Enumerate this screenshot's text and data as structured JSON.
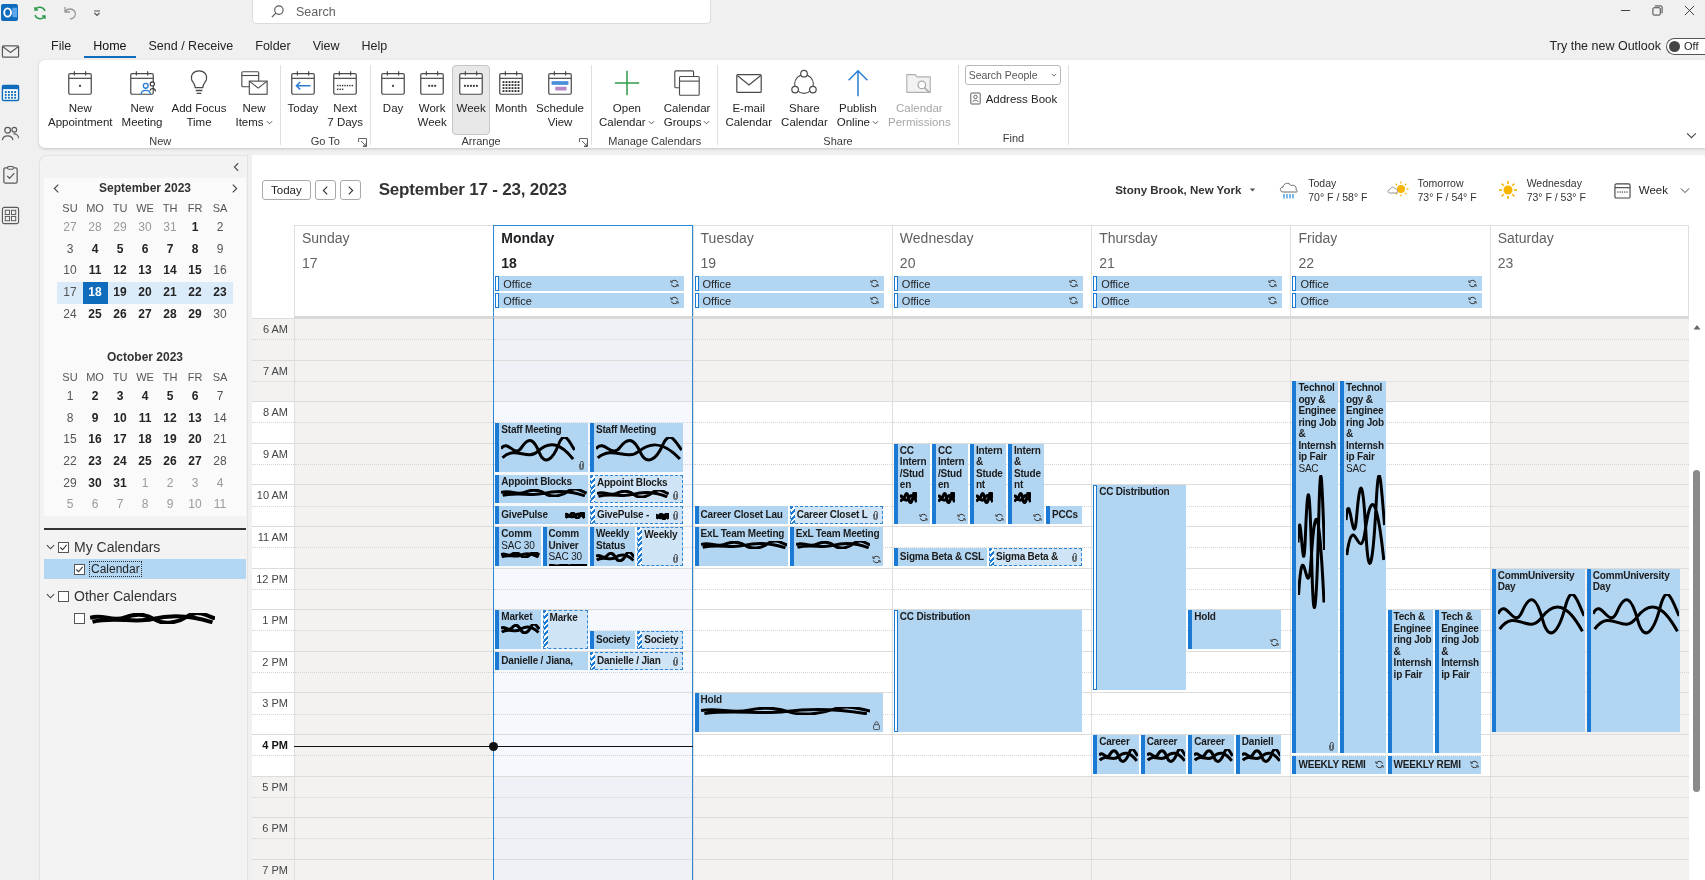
{
  "title_bar": {
    "search": {
      "placeholder": "Search"
    }
  },
  "nav_rail": [
    {
      "selected": false
    },
    {
      "selected": true
    },
    {
      "selected": false
    },
    {
      "selected": false
    },
    {
      "selected": false
    }
  ],
  "menu_tabs": [
    {
      "label": "File",
      "selected": false
    },
    {
      "label": "Home",
      "selected": true
    },
    {
      "label": "Send / Receive",
      "selected": false
    },
    {
      "label": "Folder",
      "selected": false
    },
    {
      "label": "View",
      "selected": false
    },
    {
      "label": "Help",
      "selected": false
    }
  ],
  "new_outlook": {
    "label": "Try the new Outlook",
    "toggle_text": "Off",
    "on": false
  },
  "ribbon": {
    "groups": [
      {
        "label": "New",
        "launcher": false,
        "buttons": [
          {
            "label": "New\nAppointment",
            "menu": false,
            "selected": false,
            "disabled": false
          },
          {
            "label": "New\nMeeting",
            "menu": false,
            "selected": false,
            "disabled": false
          },
          {
            "label": "Add Focus\nTime",
            "menu": false,
            "selected": false,
            "disabled": false
          },
          {
            "label": "New\nItems",
            "menu": true,
            "selected": false,
            "disabled": false
          }
        ]
      },
      {
        "label": "Go To",
        "launcher": true,
        "buttons": [
          {
            "label": "Today",
            "menu": false,
            "selected": false,
            "disabled": false
          },
          {
            "label": "Next\n7 Days",
            "menu": false,
            "selected": false,
            "disabled": false
          }
        ]
      },
      {
        "label": "Arrange",
        "launcher": true,
        "buttons": [
          {
            "label": "Day",
            "menu": false,
            "selected": false,
            "disabled": false
          },
          {
            "label": "Work\nWeek",
            "menu": false,
            "selected": false,
            "disabled": false
          },
          {
            "label": "Week",
            "menu": false,
            "selected": true,
            "disabled": false
          },
          {
            "label": "Month",
            "menu": false,
            "selected": false,
            "disabled": false
          },
          {
            "label": "Schedule\nView",
            "menu": false,
            "selected": false,
            "disabled": false
          }
        ]
      },
      {
        "label": "Manage Calendars",
        "launcher": false,
        "buttons": [
          {
            "label": "Open\nCalendar",
            "menu": true,
            "selected": false,
            "disabled": false
          },
          {
            "label": "Calendar\nGroups",
            "menu": true,
            "selected": false,
            "disabled": false
          }
        ]
      },
      {
        "label": "Share",
        "launcher": false,
        "buttons": [
          {
            "label": "E-mail\nCalendar",
            "menu": false,
            "selected": false,
            "disabled": false
          },
          {
            "label": "Share\nCalendar",
            "menu": false,
            "selected": false,
            "disabled": false
          },
          {
            "label": "Publish\nOnline",
            "menu": true,
            "selected": false,
            "disabled": false
          },
          {
            "label": "Calendar\nPermissions",
            "menu": false,
            "selected": false,
            "disabled": true
          }
        ]
      }
    ],
    "find": {
      "label": "Find",
      "search_people": {
        "placeholder": "Search People"
      },
      "address_book": {
        "label": "Address Book"
      }
    }
  },
  "sidebar": {
    "months": [
      {
        "title": "September 2023",
        "arrows": true,
        "weekdays": [
          "SU",
          "MO",
          "TU",
          "WE",
          "TH",
          "FR",
          "SA"
        ],
        "weeks": [
          {
            "selected": false,
            "days": [
              {
                "day": "27",
                "other_month": true,
                "busy": false,
                "today": false
              },
              {
                "day": "28",
                "other_month": true,
                "busy": false,
                "today": false
              },
              {
                "day": "29",
                "other_month": true,
                "busy": false,
                "today": false
              },
              {
                "day": "30",
                "other_month": true,
                "busy": false,
                "today": false
              },
              {
                "day": "31",
                "other_month": true,
                "busy": false,
                "today": false
              },
              {
                "day": "1",
                "other_month": false,
                "busy": true,
                "today": false
              },
              {
                "day": "2",
                "other_month": false,
                "busy": false,
                "today": false
              }
            ]
          },
          {
            "selected": false,
            "days": [
              {
                "day": "3",
                "other_month": false,
                "busy": false,
                "today": false
              },
              {
                "day": "4",
                "other_month": false,
                "busy": true,
                "today": false
              },
              {
                "day": "5",
                "other_month": false,
                "busy": true,
                "today": false
              },
              {
                "day": "6",
                "other_month": false,
                "busy": true,
                "today": false
              },
              {
                "day": "7",
                "other_month": false,
                "busy": true,
                "today": false
              },
              {
                "day": "8",
                "other_month": false,
                "busy": true,
                "today": false
              },
              {
                "day": "9",
                "other_month": false,
                "busy": false,
                "today": false
              }
            ]
          },
          {
            "selected": false,
            "days": [
              {
                "day": "10",
                "other_month": false,
                "busy": false,
                "today": false
              },
              {
                "day": "11",
                "other_month": false,
                "busy": true,
                "today": false
              },
              {
                "day": "12",
                "other_month": false,
                "busy": true,
                "today": false
              },
              {
                "day": "13",
                "other_month": false,
                "busy": true,
                "today": false
              },
              {
                "day": "14",
                "other_month": false,
                "busy": true,
                "today": false
              },
              {
                "day": "15",
                "other_month": false,
                "busy": true,
                "today": false
              },
              {
                "day": "16",
                "other_month": false,
                "busy": false,
                "today": false
              }
            ]
          },
          {
            "selected": true,
            "days": [
              {
                "day": "17",
                "other_month": false,
                "busy": false,
                "today": false
              },
              {
                "day": "18",
                "other_month": false,
                "busy": true,
                "today": true
              },
              {
                "day": "19",
                "other_month": false,
                "busy": true,
                "today": false
              },
              {
                "day": "20",
                "other_month": false,
                "busy": true,
                "today": false
              },
              {
                "day": "21",
                "other_month": false,
                "busy": true,
                "today": false
              },
              {
                "day": "22",
                "other_month": false,
                "busy": true,
                "today": false
              },
              {
                "day": "23",
                "other_month": false,
                "busy": true,
                "today": false
              }
            ]
          },
          {
            "selected": false,
            "days": [
              {
                "day": "24",
                "other_month": false,
                "busy": false,
                "today": false
              },
              {
                "day": "25",
                "other_month": false,
                "busy": true,
                "today": false
              },
              {
                "day": "26",
                "other_month": false,
                "busy": true,
                "today": false
              },
              {
                "day": "27",
                "other_month": false,
                "busy": true,
                "today": false
              },
              {
                "day": "28",
                "other_month": false,
                "busy": true,
                "today": false
              },
              {
                "day": "29",
                "other_month": false,
                "busy": true,
                "today": false
              },
              {
                "day": "30",
                "other_month": false,
                "busy": false,
                "today": false
              }
            ]
          }
        ]
      },
      {
        "title": "October 2023",
        "arrows": false,
        "weekdays": [
          "SU",
          "MO",
          "TU",
          "WE",
          "TH",
          "FR",
          "SA"
        ],
        "weeks": [
          {
            "selected": false,
            "days": [
              {
                "day": "1",
                "other_month": false,
                "busy": false,
                "today": false
              },
              {
                "day": "2",
                "other_month": false,
                "busy": true,
                "today": false
              },
              {
                "day": "3",
                "other_month": false,
                "busy": true,
                "today": false
              },
              {
                "day": "4",
                "other_month": false,
                "busy": true,
                "today": false
              },
              {
                "day": "5",
                "other_month": false,
                "busy": true,
                "today": false
              },
              {
                "day": "6",
                "other_month": false,
                "busy": true,
                "today": false
              },
              {
                "day": "7",
                "other_month": false,
                "busy": false,
                "today": false
              }
            ]
          },
          {
            "selected": false,
            "days": [
              {
                "day": "8",
                "other_month": false,
                "busy": false,
                "today": false
              },
              {
                "day": "9",
                "other_month": false,
                "busy": true,
                "today": false
              },
              {
                "day": "10",
                "other_month": false,
                "busy": true,
                "today": false
              },
              {
                "day": "11",
                "other_month": false,
                "busy": true,
                "today": false
              },
              {
                "day": "12",
                "other_month": false,
                "busy": true,
                "today": false
              },
              {
                "day": "13",
                "other_month": false,
                "busy": true,
                "today": false
              },
              {
                "day": "14",
                "other_month": false,
                "busy": false,
                "today": false
              }
            ]
          },
          {
            "selected": false,
            "days": [
              {
                "day": "15",
                "other_month": false,
                "busy": false,
                "today": false
              },
              {
                "day": "16",
                "other_month": false,
                "busy": true,
                "today": false
              },
              {
                "day": "17",
                "other_month": false,
                "busy": true,
                "today": false
              },
              {
                "day": "18",
                "other_month": false,
                "busy": true,
                "today": false
              },
              {
                "day": "19",
                "other_month": false,
                "busy": true,
                "today": false
              },
              {
                "day": "20",
                "other_month": false,
                "busy": true,
                "today": false
              },
              {
                "day": "21",
                "other_month": false,
                "busy": false,
                "today": false
              }
            ]
          },
          {
            "selected": false,
            "days": [
              {
                "day": "22",
                "other_month": false,
                "busy": false,
                "today": false
              },
              {
                "day": "23",
                "other_month": false,
                "busy": true,
                "today": false
              },
              {
                "day": "24",
                "other_month": false,
                "busy": true,
                "today": false
              },
              {
                "day": "25",
                "other_month": false,
                "busy": true,
                "today": false
              },
              {
                "day": "26",
                "other_month": false,
                "busy": true,
                "today": false
              },
              {
                "day": "27",
                "other_month": false,
                "busy": true,
                "today": false
              },
              {
                "day": "28",
                "other_month": false,
                "busy": false,
                "today": false
              }
            ]
          },
          {
            "selected": false,
            "days": [
              {
                "day": "29",
                "other_month": false,
                "busy": false,
                "today": false
              },
              {
                "day": "30",
                "other_month": false,
                "busy": true,
                "today": false
              },
              {
                "day": "31",
                "other_month": false,
                "busy": true,
                "today": false
              },
              {
                "day": "1",
                "other_month": true,
                "busy": false,
                "today": false
              },
              {
                "day": "2",
                "other_month": true,
                "busy": false,
                "today": false
              },
              {
                "day": "3",
                "other_month": true,
                "busy": false,
                "today": false
              },
              {
                "day": "4",
                "other_month": true,
                "busy": false,
                "today": false
              }
            ]
          },
          {
            "selected": false,
            "days": [
              {
                "day": "5",
                "other_month": true,
                "busy": false,
                "today": false
              },
              {
                "day": "6",
                "other_month": true,
                "busy": false,
                "today": false
              },
              {
                "day": "7",
                "other_month": true,
                "busy": false,
                "today": false
              },
              {
                "day": "8",
                "other_month": true,
                "busy": false,
                "today": false
              },
              {
                "day": "9",
                "other_month": true,
                "busy": false,
                "today": false
              },
              {
                "day": "10",
                "other_month": true,
                "busy": false,
                "today": false
              },
              {
                "day": "11",
                "other_month": true,
                "busy": false,
                "today": false
              }
            ]
          }
        ]
      }
    ],
    "calendars": [
      {
        "label": "My Calendars",
        "checked": true,
        "expanded": true,
        "selected": false,
        "children": [
          {
            "label": "Calendar",
            "checked": true,
            "selected": true,
            "redacted": false
          }
        ]
      },
      {
        "label": "Other Calendars",
        "checked": false,
        "expanded": true,
        "selected": false,
        "children": [
          {
            "checked": false,
            "selected": false,
            "redacted": true
          }
        ]
      }
    ]
  },
  "calendar": {
    "toolbar": {
      "today_button": "Today",
      "title": "September 17 - 23, 2023",
      "location": "Stony Brook, New York",
      "weather": [
        {
          "kind": "rain",
          "day": "Today",
          "temps": "70° F / 58° F"
        },
        {
          "kind": "partly_sunny",
          "day": "Tomorrow",
          "temps": "73° F / 54° F"
        },
        {
          "kind": "sunny",
          "day": "Wednesday",
          "temps": "73° F / 53° F"
        }
      ],
      "view": "Week"
    },
    "hours": [
      {
        "label": "6 AM",
        "current": false
      },
      {
        "label": "7 AM",
        "current": false
      },
      {
        "label": "8 AM",
        "current": false
      },
      {
        "label": "9 AM",
        "current": false
      },
      {
        "label": "10 AM",
        "current": false
      },
      {
        "label": "11 AM",
        "current": false
      },
      {
        "label": "12 PM",
        "current": false
      },
      {
        "label": "1 PM",
        "current": false
      },
      {
        "label": "2 PM",
        "current": false
      },
      {
        "label": "3 PM",
        "current": false
      },
      {
        "label": "4 PM",
        "current": true
      },
      {
        "label": "5 PM",
        "current": false
      },
      {
        "label": "6 PM",
        "current": false
      },
      {
        "label": "7 PM",
        "current": false
      }
    ],
    "days": [
      {
        "name": "Sunday",
        "date": "17",
        "today": false,
        "workday": false
      },
      {
        "name": "Monday",
        "date": "18",
        "today": true,
        "workday": true,
        "all_day": [
          {
            "title": "Office",
            "kind": "free",
            "recurring": true
          },
          {
            "title": "Office",
            "kind": "free",
            "recurring": true
          }
        ],
        "events": [
          {
            "title": "Staff Meeting",
            "kind": "busy",
            "recurring": false,
            "attachment": true,
            "private": false,
            "redacted": true
          },
          {
            "title": "Staff Meeting",
            "kind": "busy",
            "recurring": false,
            "attachment": false,
            "private": false,
            "redacted": true
          },
          {
            "title": "Appoint Blocks",
            "kind": "busy",
            "recurring": false,
            "attachment": false,
            "private": false,
            "redacted": true
          },
          {
            "title": "Appoint Blocks",
            "kind": "tentative",
            "recurring": false,
            "attachment": true,
            "private": false,
            "redacted": true
          },
          {
            "title": "GivePulse",
            "kind": "busy",
            "recurring": false,
            "attachment": false,
            "private": false,
            "redacted": true
          },
          {
            "title": "GivePulse -",
            "kind": "tentative",
            "recurring": false,
            "attachment": true,
            "private": false,
            "redacted": true
          },
          {
            "title": "Comm",
            "location": "SAC 30",
            "kind": "busy",
            "recurring": false,
            "attachment": false,
            "private": false,
            "redacted": true
          },
          {
            "title": "Comm Univer",
            "location": "SAC 30",
            "kind": "busy",
            "recurring": false,
            "attachment": false,
            "private": false,
            "redacted": true
          },
          {
            "title": "Weekly Status",
            "kind": "busy",
            "recurring": false,
            "attachment": false,
            "private": false,
            "redacted": true
          },
          {
            "title": "Weekly",
            "kind": "tentative",
            "recurring": false,
            "attachment": true,
            "private": false,
            "redacted": false
          },
          {
            "title": "Market",
            "kind": "busy",
            "recurring": false,
            "attachment": false,
            "private": false,
            "redacted": true
          },
          {
            "title": "Marke",
            "kind": "tentative",
            "recurring": false,
            "attachment": false,
            "private": false,
            "redacted": false
          },
          {
            "title": "Society",
            "kind": "busy",
            "recurring": false,
            "attachment": false,
            "private": false,
            "redacted": false
          },
          {
            "title": "Society",
            "kind": "tentative",
            "recurring": false,
            "attachment": false,
            "private": false,
            "redacted": false
          },
          {
            "title": "Danielle / Jiana,",
            "kind": "busy",
            "recurring": false,
            "attachment": false,
            "private": false,
            "redacted": false
          },
          {
            "title": "Danielle / Jian",
            "kind": "tentative",
            "recurring": false,
            "attachment": true,
            "private": false,
            "redacted": false
          }
        ]
      },
      {
        "name": "Tuesday",
        "date": "19",
        "today": false,
        "workday": true,
        "all_day": [
          {
            "title": "Office",
            "kind": "free",
            "recurring": true
          },
          {
            "title": "Office",
            "kind": "free",
            "recurring": true
          }
        ],
        "events": [
          {
            "title": "Career Closet Lau",
            "kind": "busy",
            "recurring": false,
            "attachment": false,
            "private": false,
            "redacted": false
          },
          {
            "title": "Career Closet L",
            "kind": "tentative",
            "recurring": false,
            "attachment": true,
            "private": false,
            "redacted": false
          },
          {
            "title": "ExL Team Meeting",
            "kind": "busy",
            "recurring": false,
            "attachment": false,
            "private": false,
            "redacted": true
          },
          {
            "title": "ExL Team Meeting",
            "kind": "busy",
            "recurring": true,
            "attachment": false,
            "private": false,
            "redacted": true
          },
          {
            "title": "Hold",
            "kind": "busy",
            "recurring": false,
            "attachment": false,
            "private": true,
            "redacted": true
          }
        ]
      },
      {
        "name": "Wednesday",
        "date": "20",
        "today": false,
        "workday": true,
        "all_day": [
          {
            "title": "Office",
            "kind": "free",
            "recurring": true
          },
          {
            "title": "Office",
            "kind": "free",
            "recurring": true
          }
        ],
        "events": [
          {
            "title": "CC Intern/Studen",
            "kind": "busy",
            "recurring": true,
            "attachment": false,
            "private": false,
            "redacted": true
          },
          {
            "title": "CC Intern/Studen",
            "kind": "busy",
            "recurring": true,
            "attachment": false,
            "private": false,
            "redacted": true
          },
          {
            "title": "Intern & Student",
            "kind": "busy",
            "recurring": true,
            "attachment": false,
            "private": false,
            "redacted": true
          },
          {
            "title": "Intern & Student",
            "kind": "busy",
            "recurring": true,
            "attachment": false,
            "private": false,
            "redacted": true
          },
          {
            "title": "PCCs",
            "kind": "busy",
            "recurring": false,
            "attachment": false,
            "private": false,
            "redacted": false
          },
          {
            "title": "Sigma Beta & CSL",
            "kind": "busy",
            "recurring": false,
            "attachment": false,
            "private": false,
            "redacted": false
          },
          {
            "title": "Sigma Beta &",
            "kind": "tentative",
            "recurring": false,
            "attachment": true,
            "private": false,
            "redacted": false
          },
          {
            "title": "CC Distribution",
            "kind": "free",
            "recurring": false,
            "attachment": false,
            "private": false,
            "redacted": false
          }
        ]
      },
      {
        "name": "Thursday",
        "date": "21",
        "today": false,
        "workday": true,
        "all_day": [
          {
            "title": "Office",
            "kind": "free",
            "recurring": true
          },
          {
            "title": "Office",
            "kind": "free",
            "recurring": true
          }
        ],
        "events": [
          {
            "title": "CC Distribution",
            "kind": "free",
            "recurring": false,
            "attachment": false,
            "private": false,
            "redacted": false
          },
          {
            "title": "Hold",
            "kind": "busy",
            "recurring": true,
            "attachment": false,
            "private": false,
            "redacted": false
          },
          {
            "title": "Career",
            "kind": "busy",
            "recurring": false,
            "attachment": false,
            "private": false,
            "redacted": true
          },
          {
            "title": "Career",
            "kind": "busy",
            "recurring": false,
            "attachment": false,
            "private": false,
            "redacted": true
          },
          {
            "title": "Career",
            "kind": "busy",
            "recurring": false,
            "attachment": false,
            "private": false,
            "redacted": true
          },
          {
            "title": "Daniell",
            "kind": "busy",
            "recurring": false,
            "attachment": false,
            "private": false,
            "redacted": true
          }
        ]
      },
      {
        "name": "Friday",
        "date": "22",
        "today": false,
        "workday": true,
        "all_day": [
          {
            "title": "Office",
            "kind": "free",
            "recurring": true
          },
          {
            "title": "Office",
            "kind": "free",
            "recurring": true
          }
        ],
        "events": [
          {
            "title": "Technology & Engineering Job & Internship Fair",
            "location": "SAC",
            "kind": "busy",
            "recurring": false,
            "attachment": true,
            "private": false,
            "redacted": true
          },
          {
            "title": "Technology & Engineering Job & Internship Fair",
            "location": "SAC",
            "kind": "busy",
            "recurring": false,
            "attachment": false,
            "private": false,
            "redacted": true
          },
          {
            "title": "Tech & Engineering Job & Internship Fair",
            "kind": "busy",
            "recurring": false,
            "attachment": false,
            "private": false,
            "redacted": false
          },
          {
            "title": "Tech & Engineering Job & Internship Fair",
            "kind": "busy",
            "recurring": false,
            "attachment": false,
            "private": false,
            "redacted": false
          },
          {
            "title": "WEEKLY REMI",
            "kind": "busy",
            "recurring": true,
            "attachment": false,
            "private": false,
            "redacted": false
          },
          {
            "title": "WEEKLY REMI",
            "kind": "busy",
            "recurring": true,
            "attachment": false,
            "private": false,
            "redacted": false
          }
        ]
      },
      {
        "name": "Saturday",
        "date": "23",
        "today": false,
        "workday": false,
        "events": [
          {
            "title": "CommUniversity Day",
            "kind": "busy",
            "recurring": false,
            "attachment": false,
            "private": false,
            "redacted": true
          },
          {
            "title": "CommUniversity Day",
            "kind": "busy",
            "recurring": false,
            "attachment": false,
            "private": false,
            "redacted": true
          }
        ]
      }
    ]
  }
}
